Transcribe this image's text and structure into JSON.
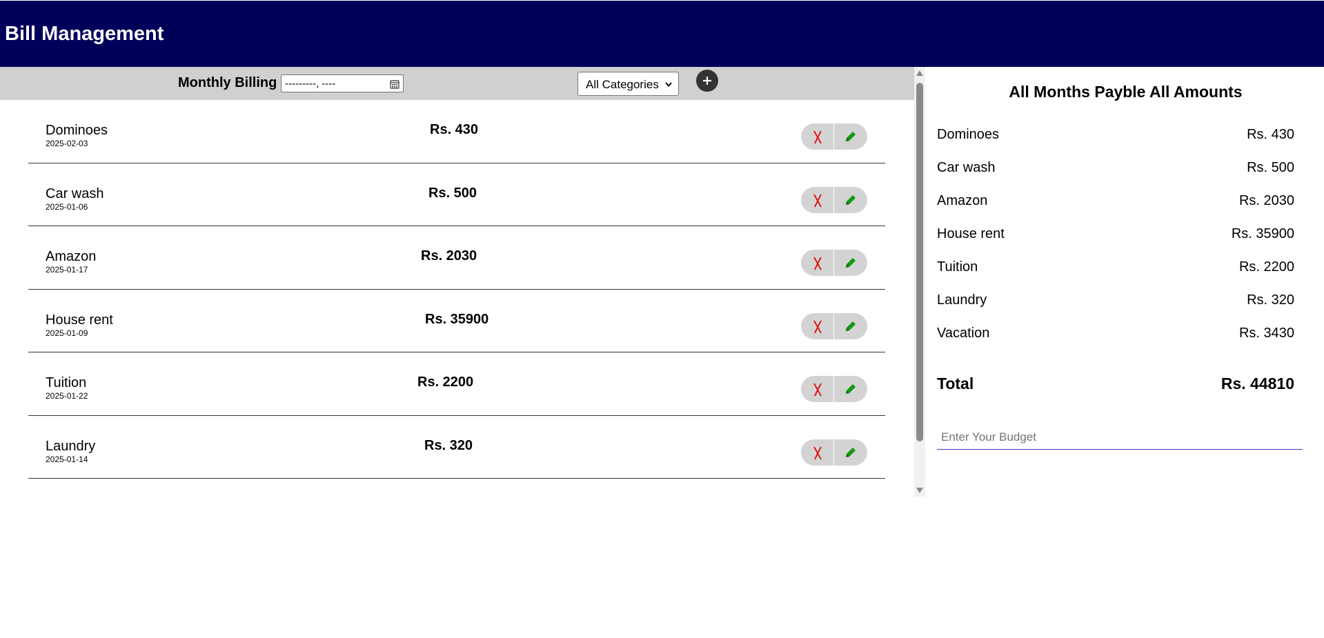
{
  "header": {
    "title": "Bill Management"
  },
  "toolbar": {
    "label": "Monthly Billing",
    "month_value": "---------, ----",
    "category_selected": "All Categories",
    "add_symbol": "+"
  },
  "bills": [
    {
      "name": "Dominoes",
      "date": "2025-02-03",
      "amount": "Rs. 430"
    },
    {
      "name": "Car wash",
      "date": "2025-01-06",
      "amount": "Rs. 500"
    },
    {
      "name": "Amazon",
      "date": "2025-01-17",
      "amount": "Rs. 2030"
    },
    {
      "name": "House rent",
      "date": "2025-01-09",
      "amount": "Rs. 35900"
    },
    {
      "name": "Tuition",
      "date": "2025-01-22",
      "amount": "Rs. 2200"
    },
    {
      "name": "Laundry",
      "date": "2025-01-14",
      "amount": "Rs. 320"
    }
  ],
  "summary": {
    "title": "All Months Payble All Amounts",
    "items": [
      {
        "name": "Dominoes",
        "amount": "Rs. 430"
      },
      {
        "name": "Car wash",
        "amount": "Rs. 500"
      },
      {
        "name": "Amazon",
        "amount": "Rs. 2030"
      },
      {
        "name": "House rent",
        "amount": "Rs. 35900"
      },
      {
        "name": "Tuition",
        "amount": "Rs. 2200"
      },
      {
        "name": "Laundry",
        "amount": "Rs. 320"
      },
      {
        "name": "Vacation",
        "amount": "Rs. 3430"
      }
    ],
    "total_label": "Total",
    "total_value": "Rs. 44810",
    "budget_placeholder": "Enter Your Budget"
  },
  "colors": {
    "header_bg": "#00005a",
    "toolbar_bg": "#d0d0d0",
    "delete_icon": "#e00000",
    "edit_icon": "#119911",
    "budget_underline": "#3a36c8"
  },
  "icons": {
    "calendar": "calendar-icon",
    "add": "plus-icon",
    "delete": "cross-icon",
    "edit": "pencil-icon",
    "dropdown": "chevron-down-icon"
  }
}
